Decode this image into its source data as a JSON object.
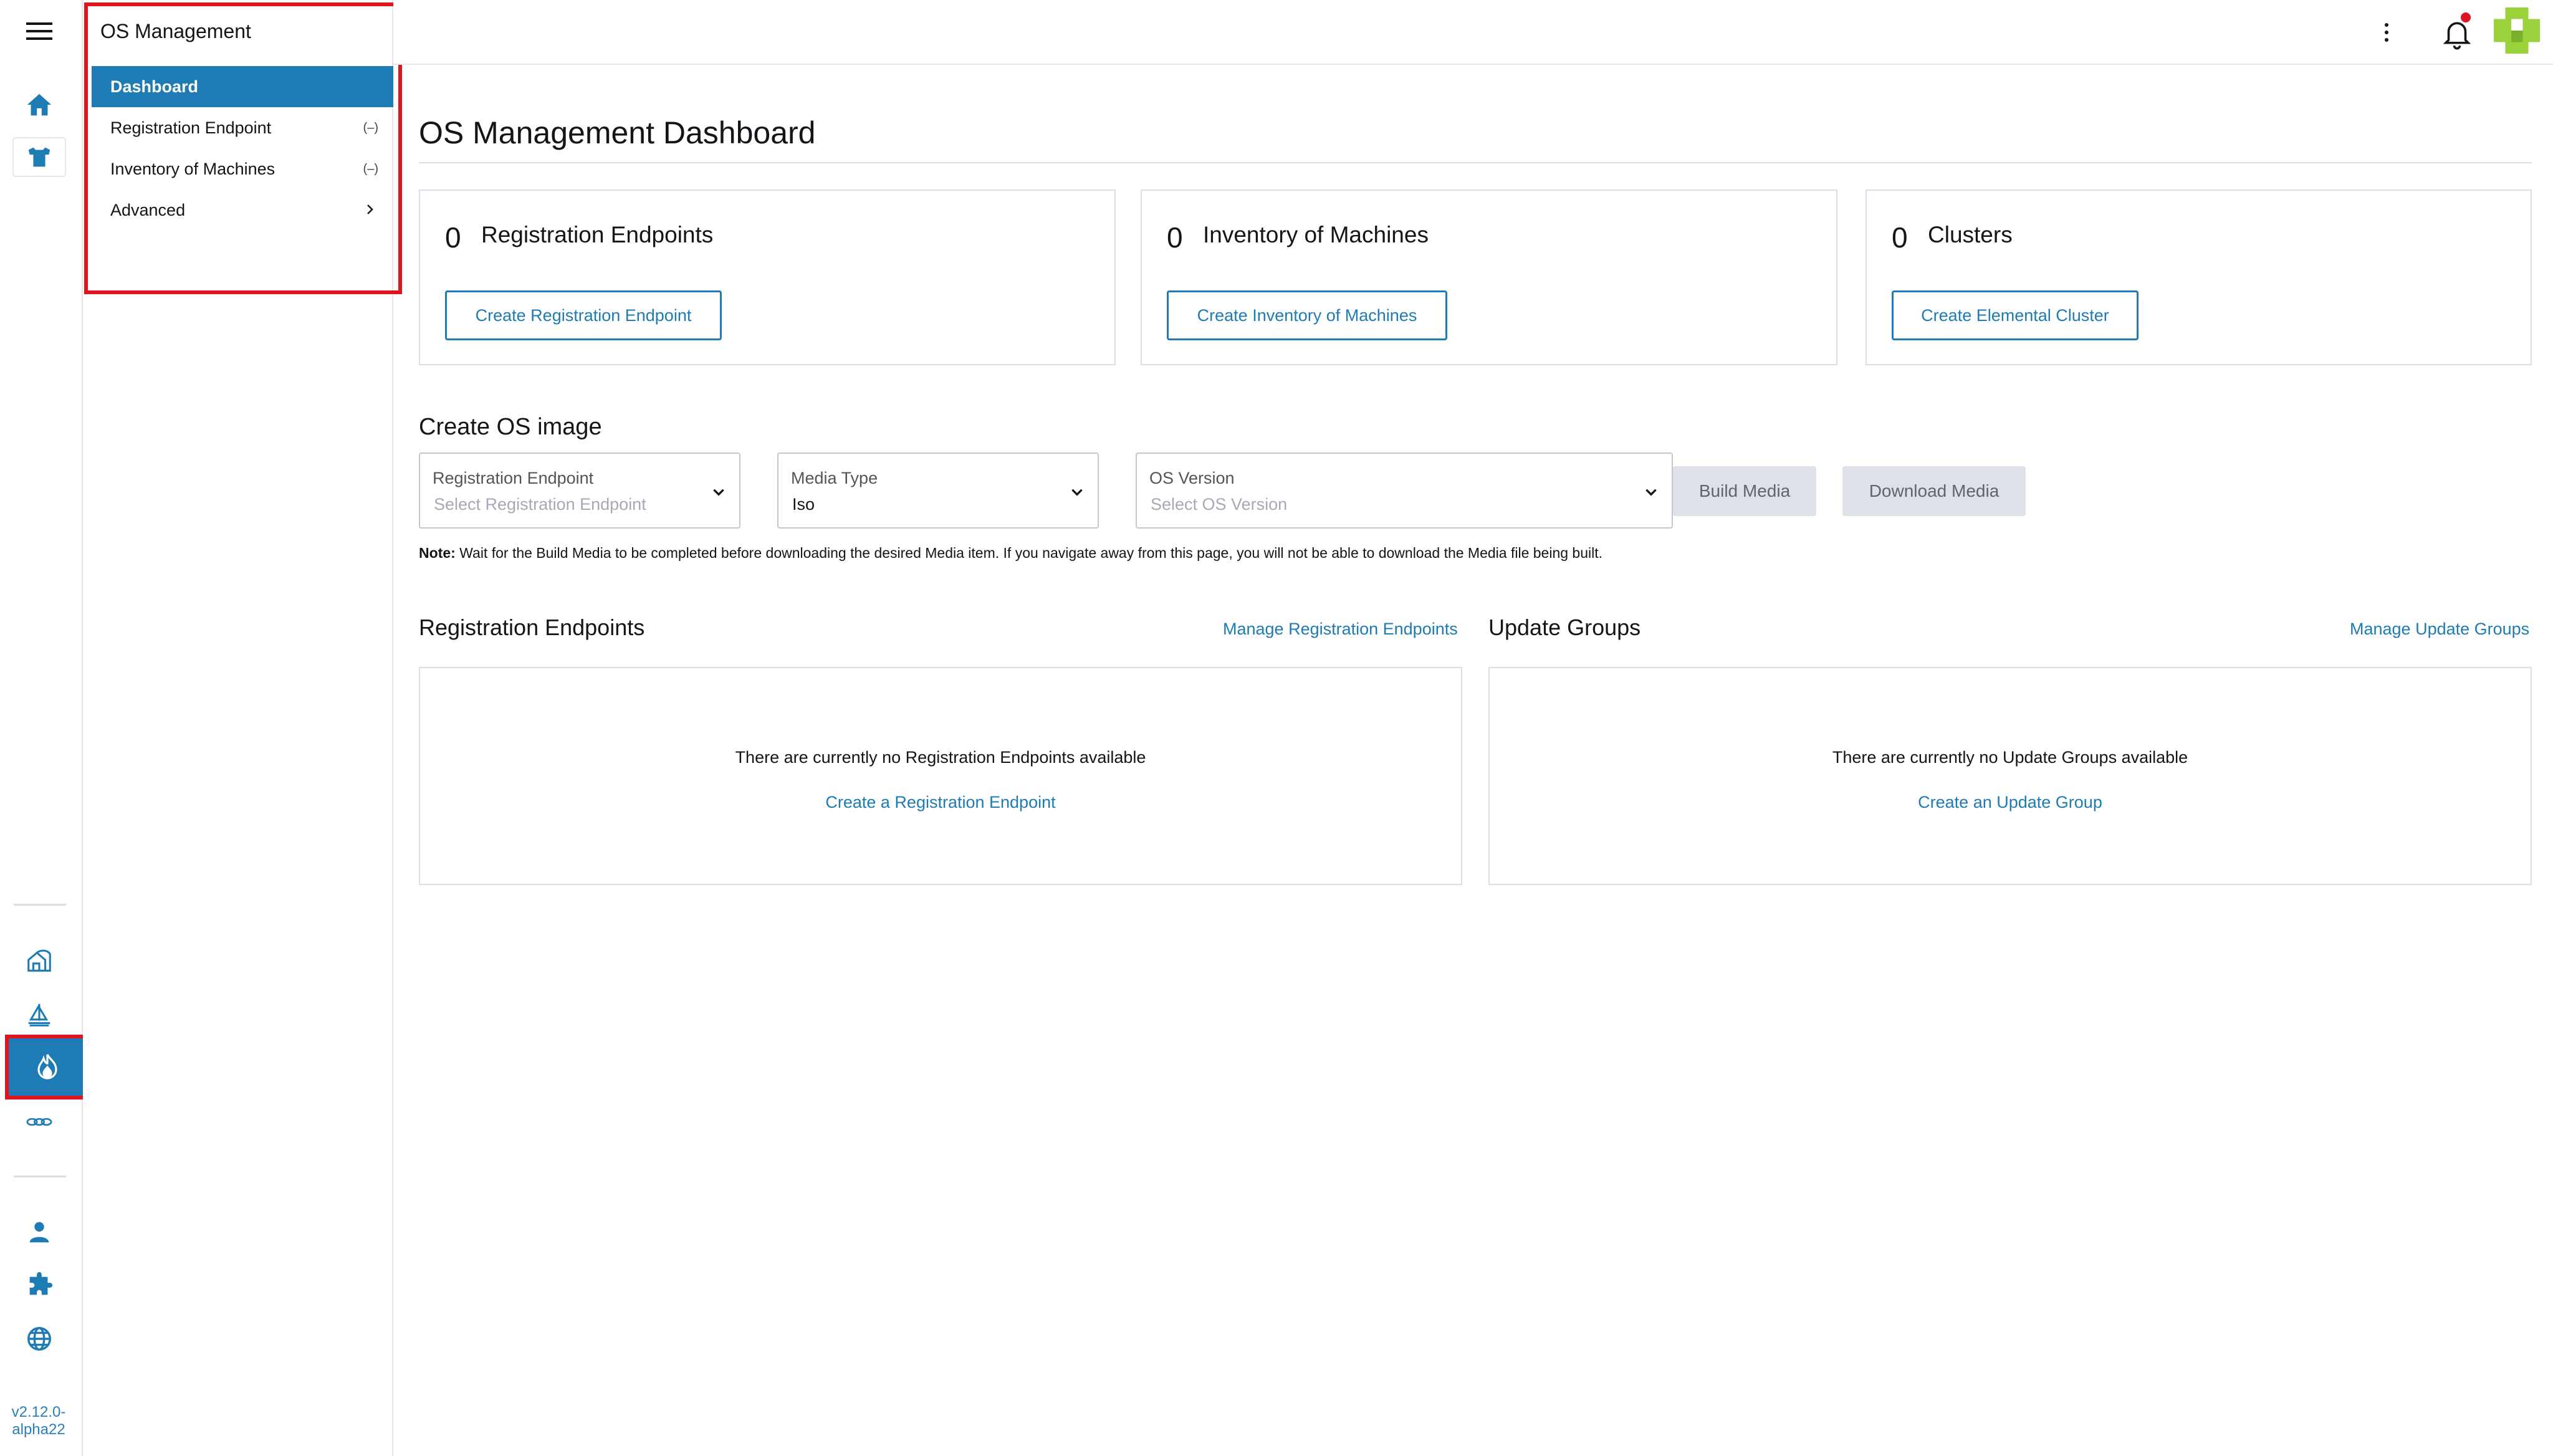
{
  "rail": {
    "version": "v2.12.0-alpha22",
    "icons": [
      "home-icon",
      "cluster-icon",
      "fleet-icon",
      "sail-icon",
      "elemental-icon",
      "chain-icon",
      "user-icon",
      "extension-icon",
      "globe-icon"
    ]
  },
  "sidenav": {
    "product_name": "OS Management",
    "items": [
      {
        "label": "Dashboard",
        "active": true
      },
      {
        "label": "Registration Endpoint",
        "badge": "(–)"
      },
      {
        "label": "Inventory of Machines",
        "badge": "(–)"
      },
      {
        "label": "Advanced",
        "expandable": true
      }
    ]
  },
  "header": {
    "accent": "#1e7bb3",
    "notification_color": "#e0141e"
  },
  "main": {
    "page_title": "OS Management Dashboard",
    "cards": [
      {
        "count": "0",
        "label": "Registration Endpoints",
        "button": "Create Registration Endpoint"
      },
      {
        "count": "0",
        "label": "Inventory of Machines",
        "button": "Create Inventory of Machines"
      },
      {
        "count": "0",
        "label": "Clusters",
        "button": "Create Elemental Cluster"
      }
    ],
    "os_image": {
      "title": "Create OS image",
      "registration_endpoint": {
        "label": "Registration Endpoint",
        "placeholder": "Select Registration Endpoint"
      },
      "media_type": {
        "label": "Media Type",
        "value": "Iso"
      },
      "os_version": {
        "label": "OS Version",
        "placeholder": "Select OS Version"
      },
      "build_button": "Build Media",
      "download_button": "Download Media",
      "note_label": "Note:",
      "note_text": " Wait for the Build Media to be completed before downloading the desired Media item. If you navigate away from this page, you will not be able to download the Media file being built."
    },
    "registration_endpoints": {
      "title": "Registration Endpoints",
      "manage_link": "Manage Registration Endpoints",
      "empty_message": "There are currently no Registration Endpoints available",
      "create_link": "Create a Registration Endpoint"
    },
    "update_groups": {
      "title": "Update Groups",
      "manage_link": "Manage Update Groups",
      "empty_message": "There are currently no Update Groups available",
      "create_link": "Create an Update Group"
    }
  }
}
